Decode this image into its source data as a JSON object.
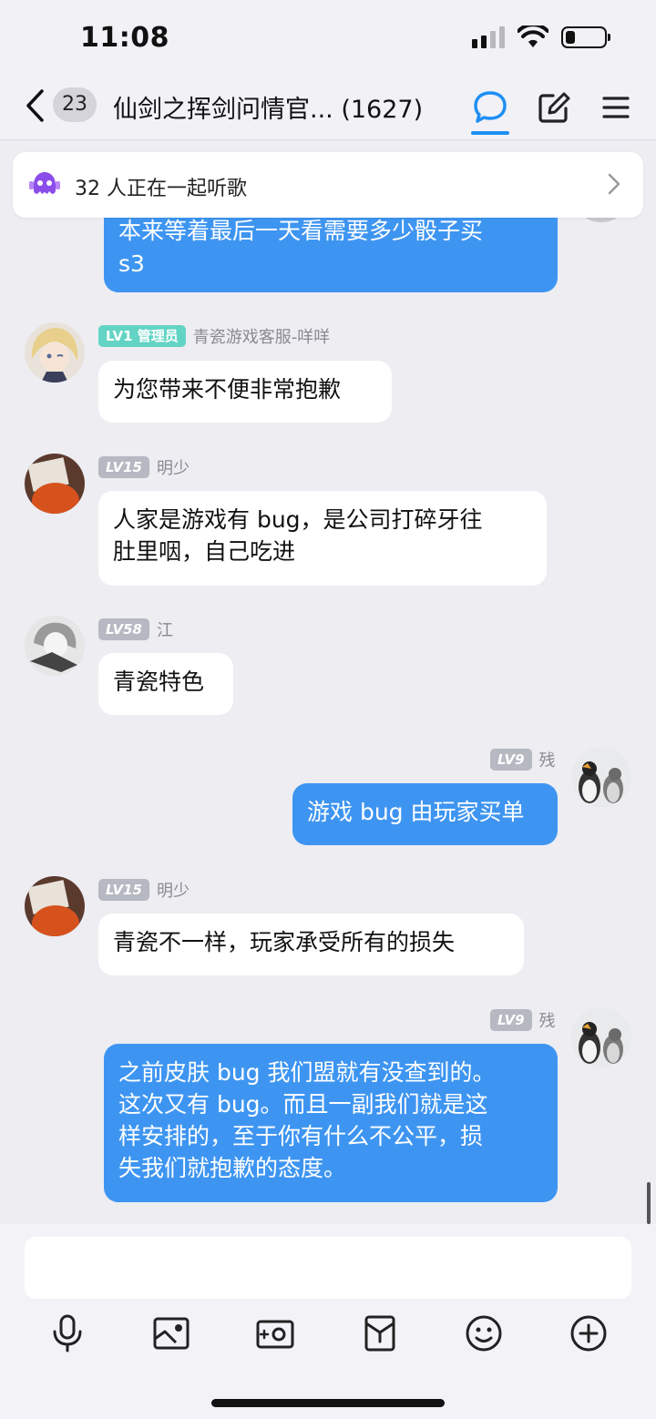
{
  "status_bar": {
    "time": "11:08"
  },
  "nav": {
    "unread_count": "23",
    "title": "仙剑之挥剑问情官... (1627)"
  },
  "listen_banner": {
    "text": "32 人正在一起听歌"
  },
  "messages": [
    {
      "lines": "本来等着最后一天看需要多少骰子买\ns3"
    },
    {
      "level": "LV1",
      "role": "管理员",
      "name": "青瓷游戏客服-咩咩",
      "text": "为您带来不便非常抱歉"
    },
    {
      "level": "LV15",
      "name": "明少",
      "text": "人家是游戏有 bug，是公司打碎牙往\n肚里咽，自己吃进"
    },
    {
      "level": "LV58",
      "name": "江",
      "text": "青瓷特色"
    },
    {
      "level": "LV9",
      "name": "残",
      "text": "游戏 bug 由玩家买单"
    },
    {
      "level": "LV15",
      "name": "明少",
      "text": "青瓷不一样，玩家承受所有的损失"
    },
    {
      "level": "LV9",
      "name": "残",
      "text": "之前皮肤 bug 我们盟就有没查到的。\n这次又有 bug。而且一副我们就是这\n样安排的，至于你有什么不公平，损\n失我们就抱歉的态度。"
    }
  ],
  "input": {
    "placeholder": ""
  },
  "colors": {
    "accent": "#1e8ff3",
    "my_bubble": "#3e95f1",
    "admin_badge": "#63d4c4"
  },
  "toolbar_icons": [
    "microphone-icon",
    "image-icon",
    "camera-icon",
    "red-packet-icon",
    "emoji-icon",
    "plus-icon"
  ]
}
